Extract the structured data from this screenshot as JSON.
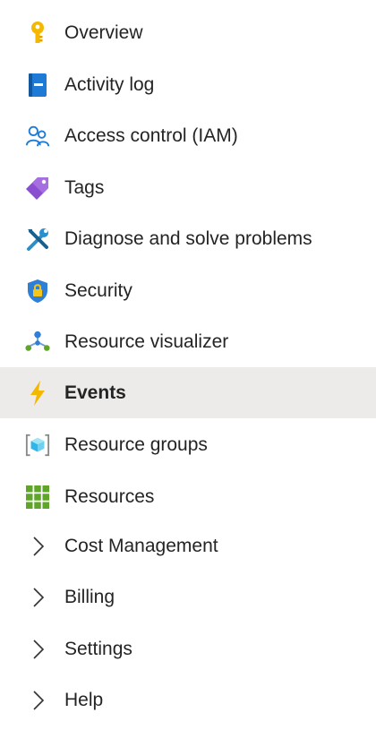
{
  "nav": {
    "items": [
      {
        "label": "Overview",
        "icon": "key-icon",
        "selected": false
      },
      {
        "label": "Activity log",
        "icon": "activity-log-icon",
        "selected": false
      },
      {
        "label": "Access control (IAM)",
        "icon": "people-icon",
        "selected": false
      },
      {
        "label": "Tags",
        "icon": "tag-icon",
        "selected": false
      },
      {
        "label": "Diagnose and solve problems",
        "icon": "wrench-screwdriver-icon",
        "selected": false
      },
      {
        "label": "Security",
        "icon": "shield-lock-icon",
        "selected": false
      },
      {
        "label": "Resource visualizer",
        "icon": "hierarchy-icon",
        "selected": false
      },
      {
        "label": "Events",
        "icon": "lightning-bolt-icon",
        "selected": true
      },
      {
        "label": "Resource groups",
        "icon": "resource-group-cube-icon",
        "selected": false
      },
      {
        "label": "Resources",
        "icon": "grid-icon",
        "selected": false
      },
      {
        "label": "Cost Management",
        "icon": "chevron-right-icon",
        "expandable": true
      },
      {
        "label": "Billing",
        "icon": "chevron-right-icon",
        "expandable": true
      },
      {
        "label": "Settings",
        "icon": "chevron-right-icon",
        "expandable": true
      },
      {
        "label": "Help",
        "icon": "chevron-right-icon",
        "expandable": true
      }
    ]
  },
  "colors": {
    "selected_background": "#edebe9",
    "text": "#242424",
    "key": "#f5b800",
    "activity_log": "#1f7ad6",
    "people": "#1f7ad6",
    "tag": "#8a4fd1",
    "tools": "#2a8ecf",
    "shield": "#2f7fd4",
    "bolt": "#f5b800",
    "grid": "#5ea529"
  }
}
